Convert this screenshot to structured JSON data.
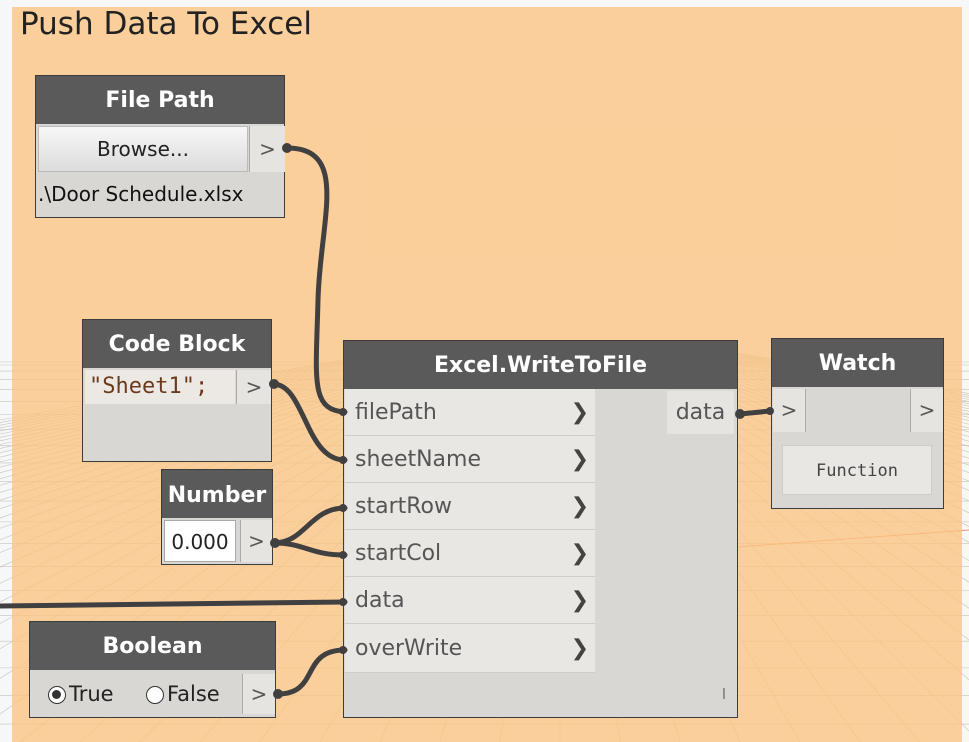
{
  "group": {
    "title": "Push Data To Excel"
  },
  "file_path_node": {
    "title": "File Path",
    "browse_label": "Browse...",
    "output_arrow": ">",
    "path_value": ".\\Door Schedule.xlsx"
  },
  "code_block_node": {
    "title": "Code Block",
    "code": "\"Sheet1\";",
    "output_arrow": ">"
  },
  "number_node": {
    "title": "Number",
    "value": "0.000",
    "output_arrow": ">"
  },
  "boolean_node": {
    "title": "Boolean",
    "true_label": "True",
    "false_label": "False",
    "selected": "True",
    "output_arrow": ">"
  },
  "excel_node": {
    "title": "Excel.WriteToFile",
    "inputs": [
      "filePath",
      "sheetName",
      "startRow",
      "startCol",
      "data",
      "overWrite"
    ],
    "output": "data",
    "lacing_mark": "l"
  },
  "watch_node": {
    "title": "Watch",
    "input_arrow": ">",
    "output_arrow": ">",
    "value": "Function"
  }
}
